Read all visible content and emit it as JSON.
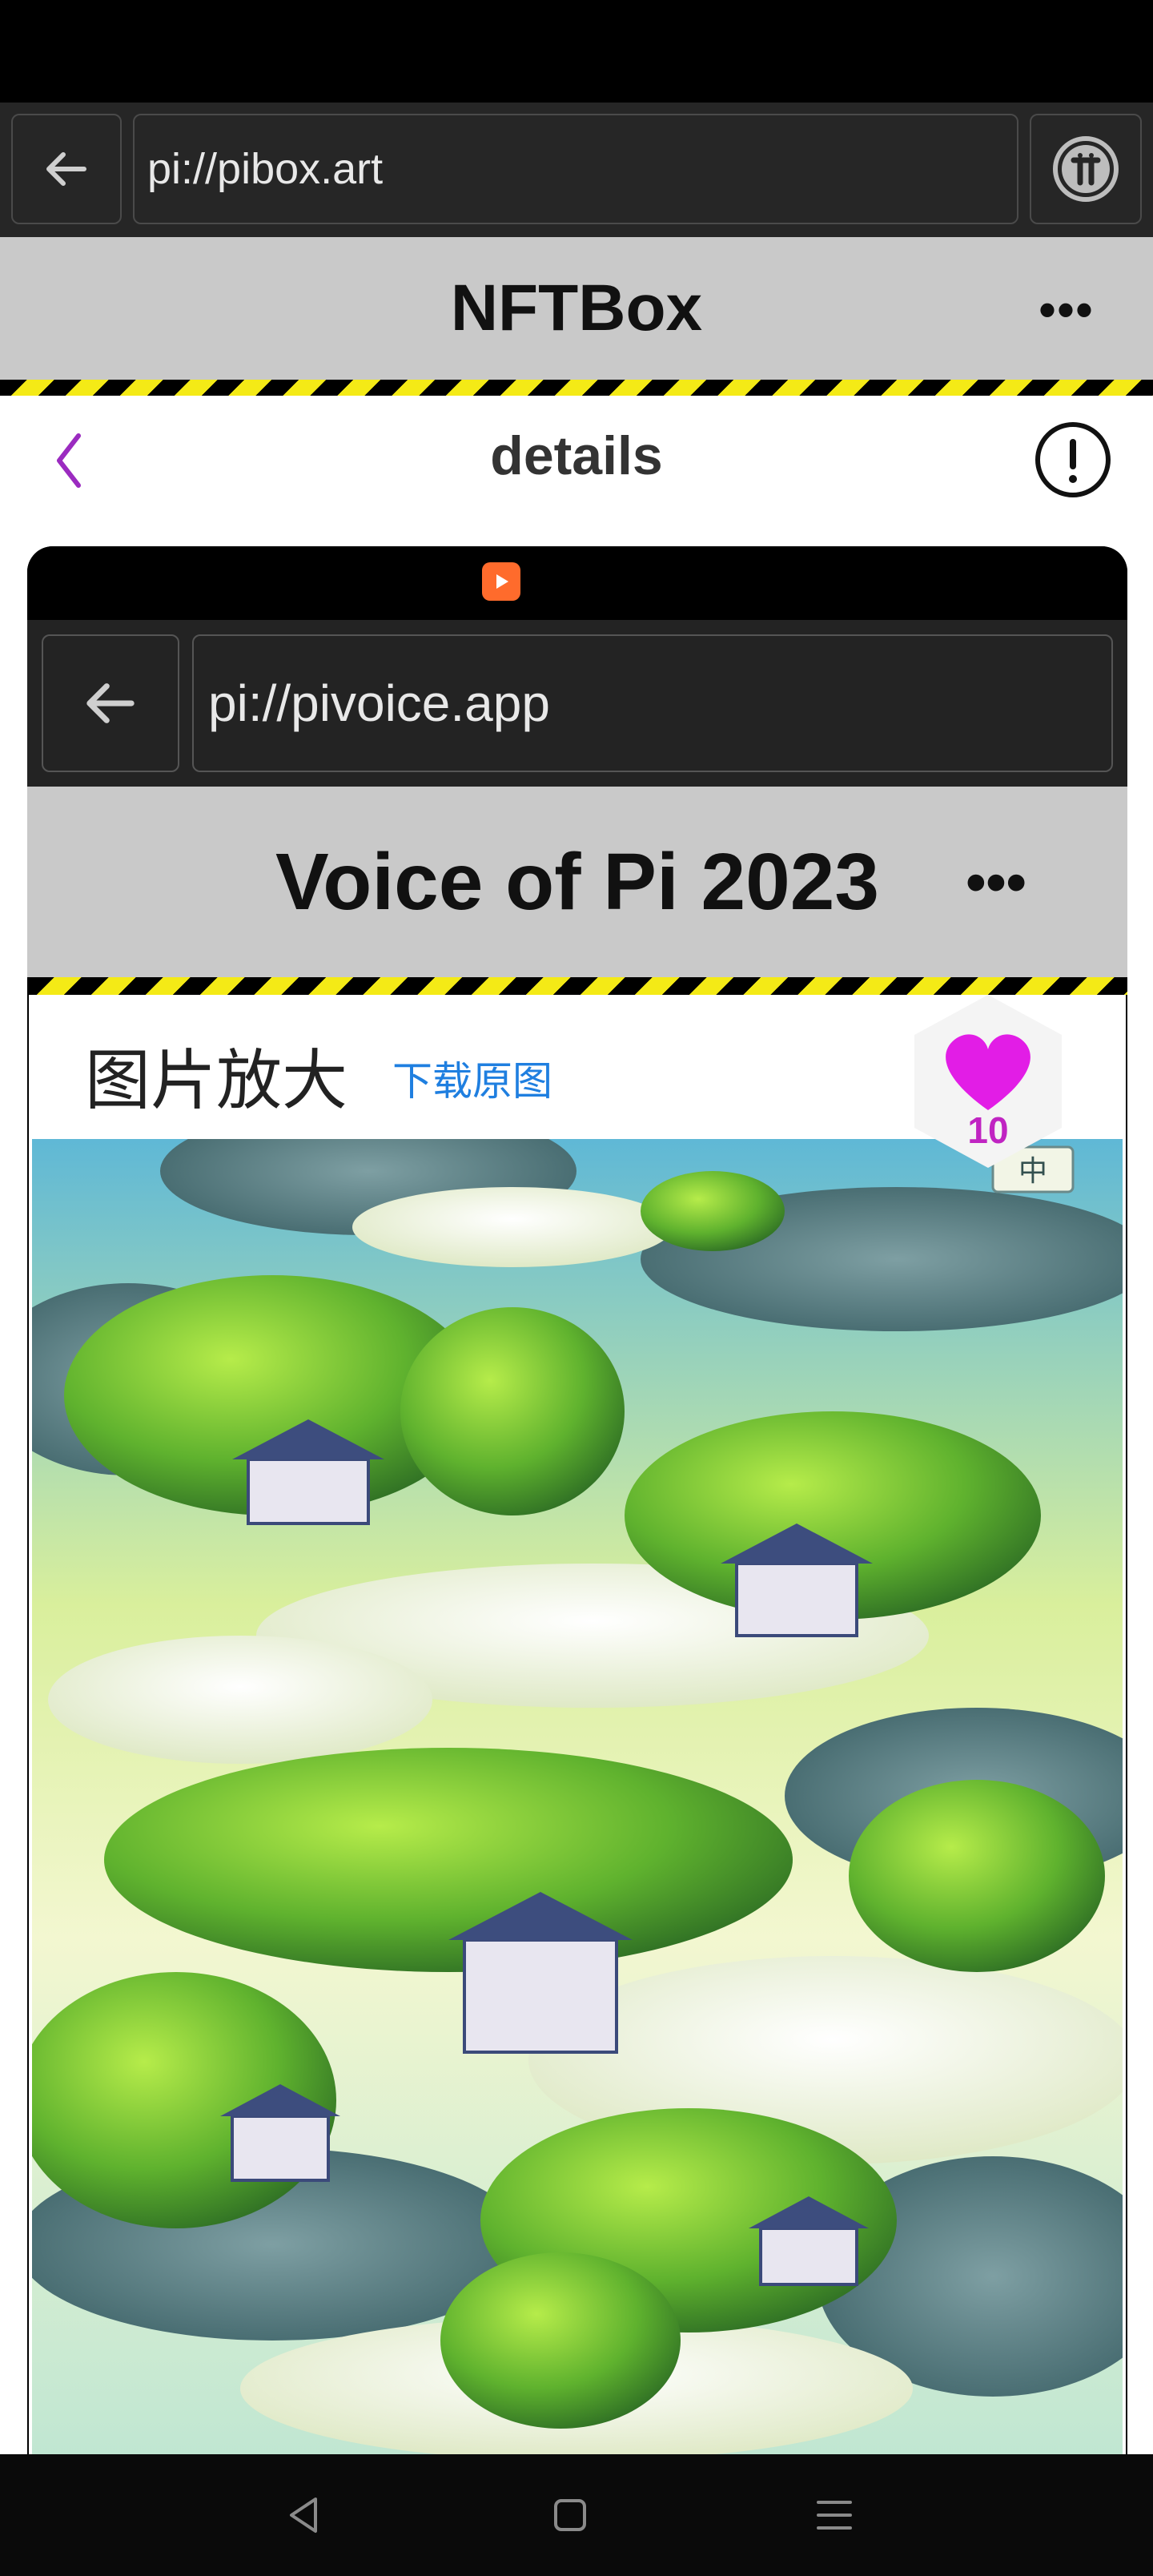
{
  "browser": {
    "url": "pi://pibox.art"
  },
  "app": {
    "title": "NFTBox",
    "more_label": "•••"
  },
  "detail": {
    "title": "details"
  },
  "inner_screenshot": {
    "url": "pi://pivoice.app",
    "title": "Voice of Pi 2023",
    "more_label": "•••",
    "zoom_panel": {
      "title": "图片放大",
      "download_label": "下载原图",
      "close_label": "×",
      "corner_tag": "中"
    }
  },
  "like": {
    "count": "10",
    "color": "#e21de6"
  },
  "colors": {
    "hazard_yellow": "#f4ea16",
    "header_gray": "#c9c9c9",
    "accent_purple": "#9b2bc0"
  },
  "nav": {
    "items": [
      "back-icon",
      "home-icon",
      "menu-icon"
    ]
  }
}
